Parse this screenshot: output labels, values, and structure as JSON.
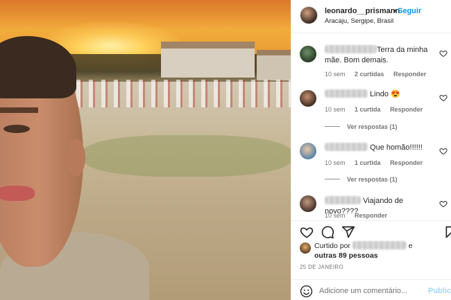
{
  "post": {
    "username": "leonardo__prismann",
    "separator": "•",
    "follow_label": "Seguir",
    "location": "Aracaju, Sergipe, Brasil"
  },
  "comments": [
    {
      "text": "Terra da minha mãe. Bom demais.",
      "age": "10 sem",
      "likes": "2 curtidas",
      "reply": "Responder"
    },
    {
      "text": "Lindo 😍",
      "age": "10 sem",
      "likes": "1 curtida",
      "reply": "Responder",
      "replies": "Ver respostas (1)"
    },
    {
      "text": "Que homão!!!!!!",
      "age": "10 sem",
      "likes": "1 curtida",
      "reply": "Responder",
      "replies": "Ver respostas (1)"
    },
    {
      "text": "Viajando de novo????",
      "age": "10 sem",
      "likes": "",
      "reply": "Responder"
    }
  ],
  "likes": {
    "prefix": "Curtido por",
    "suffix": "e",
    "others": "outras 89 pessoas"
  },
  "date": "25 DE JANEIRO",
  "add_comment": {
    "placeholder": "Adicione um comentário...",
    "publish_label": "Publicar"
  },
  "icons": {
    "like": "heart-icon",
    "comment": "comment-icon",
    "share": "share-icon",
    "save": "bookmark-icon",
    "emoji": "emoji-icon"
  },
  "colors": {
    "accent": "#0095f6",
    "muted": "#737373"
  }
}
